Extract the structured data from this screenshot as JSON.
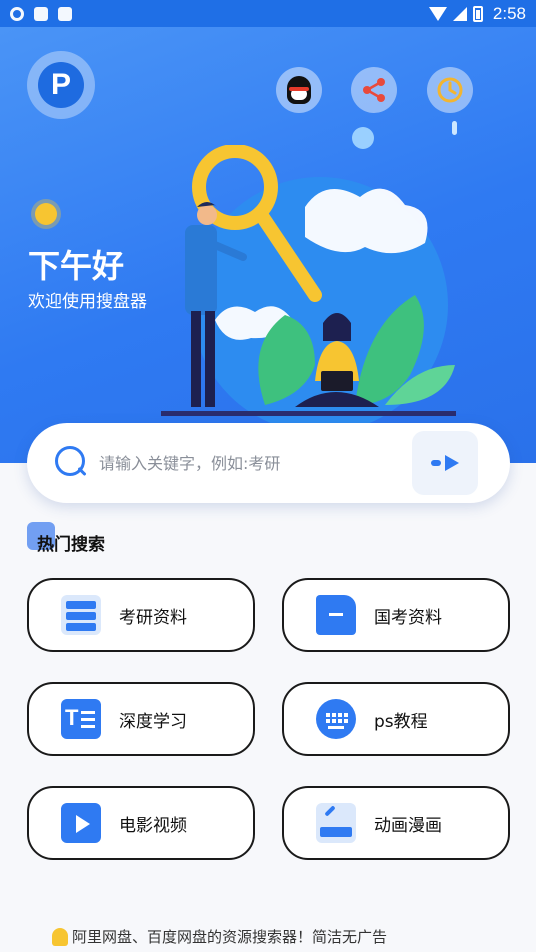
{
  "status_bar": {
    "time": "2:58"
  },
  "header": {
    "logo_letter": "P",
    "greeting": "下午好",
    "welcome": "欢迎使用搜盘器"
  },
  "search": {
    "placeholder": "请输入关键字，例如:考研"
  },
  "hot": {
    "title": "热门搜索",
    "items": [
      {
        "label": "考研资料",
        "icon": "list-icon"
      },
      {
        "label": "国考资料",
        "icon": "document-icon"
      },
      {
        "label": "深度学习",
        "icon": "text-doc-icon"
      },
      {
        "label": "ps教程",
        "icon": "keyboard-icon"
      },
      {
        "label": "电影视频",
        "icon": "video-icon"
      },
      {
        "label": "动画漫画",
        "icon": "animation-icon"
      }
    ]
  },
  "footer": {
    "text": "阿里网盘、百度网盘的资源搜索器！简洁无广告"
  },
  "colors": {
    "primary": "#2f7af2",
    "hero": "#3a85f4",
    "sun": "#f7c531"
  }
}
